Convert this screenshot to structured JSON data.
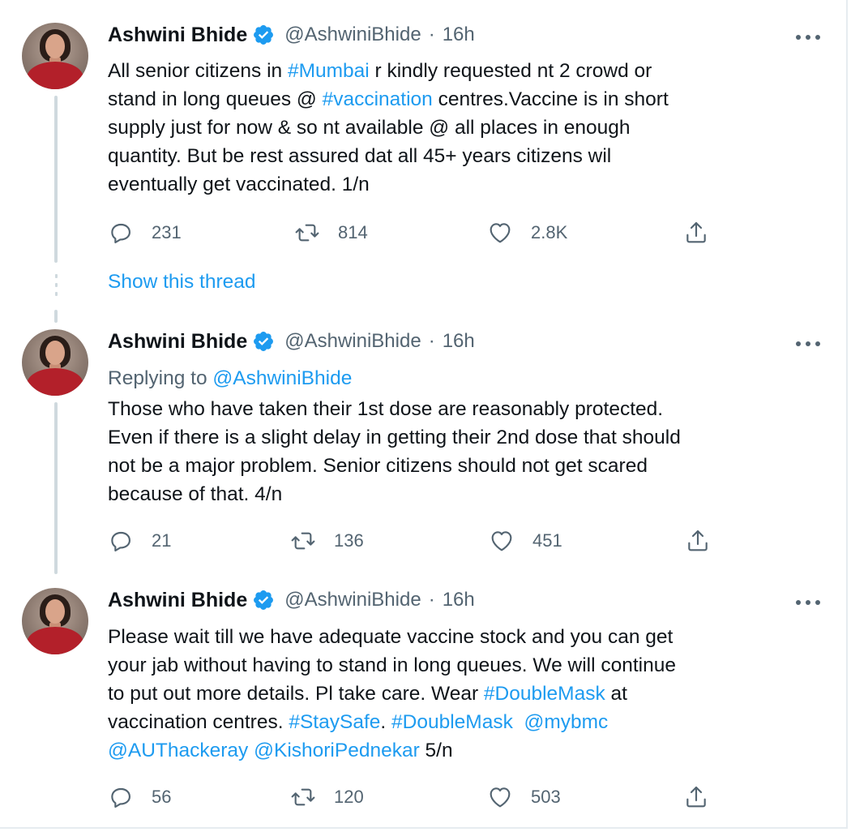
{
  "colors": {
    "link": "#1d9bf0",
    "secondary": "#536471",
    "verified": "#1d9bf0",
    "text": "#0f1419"
  },
  "show_thread": "Show this thread",
  "tweets": [
    {
      "author": {
        "name": "Ashwini Bhide",
        "handle": "@AshwiniBhide",
        "sep": "·",
        "time": "16h",
        "verified": true
      },
      "replying_prefix": "",
      "replying_to": "",
      "lines": [
        [
          {
            "t": "All senior citizens in "
          },
          {
            "t": "#Mumbai",
            "link": true
          },
          {
            "t": " r kindly requested nt 2 crowd or"
          }
        ],
        [
          {
            "t": "stand in long queues @ "
          },
          {
            "t": "#vaccination",
            "link": true
          },
          {
            "t": " centres.Vaccine is in short"
          }
        ],
        [
          {
            "t": "supply just for now & so nt available @ all places in enough"
          }
        ],
        [
          {
            "t": "quantity. But be rest assured dat all 45+ years citizens wil"
          }
        ],
        [
          {
            "t": "eventually get vaccinated. 1/n"
          }
        ]
      ],
      "stats": {
        "replies": "231",
        "retweets": "814",
        "likes": "2.8K"
      }
    },
    {
      "author": {
        "name": "Ashwini Bhide",
        "handle": "@AshwiniBhide",
        "sep": "·",
        "time": "16h",
        "verified": true
      },
      "replying_prefix": "Replying to ",
      "replying_to": "@AshwiniBhide",
      "lines": [
        [
          {
            "t": "Those who have taken their 1st dose are reasonably protected."
          }
        ],
        [
          {
            "t": "Even if there is a slight delay in getting their 2nd dose that should"
          }
        ],
        [
          {
            "t": "not be a major problem. Senior citizens should not get scared"
          }
        ],
        [
          {
            "t": "because of that. 4/n"
          }
        ]
      ],
      "stats": {
        "replies": "21",
        "retweets": "136",
        "likes": "451"
      }
    },
    {
      "author": {
        "name": "Ashwini Bhide",
        "handle": "@AshwiniBhide",
        "sep": "·",
        "time": "16h",
        "verified": true
      },
      "replying_prefix": "",
      "replying_to": "",
      "lines": [
        [
          {
            "t": "Please wait till we have adequate vaccine stock and you can get"
          }
        ],
        [
          {
            "t": "your jab without having to stand in long queues. We will continue"
          }
        ],
        [
          {
            "t": "to put out more details. Pl take care. Wear "
          },
          {
            "t": "#DoubleMask",
            "link": true
          },
          {
            "t": " at"
          }
        ],
        [
          {
            "t": "vaccination centres. "
          },
          {
            "t": "#StaySafe",
            "link": true
          },
          {
            "t": ". "
          },
          {
            "t": "#DoubleMask",
            "link": true
          },
          {
            "t": "  "
          },
          {
            "t": "@mybmc",
            "link": true
          }
        ],
        [
          {
            "t": "@AUThackeray",
            "link": true
          },
          {
            "t": " "
          },
          {
            "t": "@KishoriPednekar",
            "link": true
          },
          {
            "t": " 5/n"
          }
        ]
      ],
      "stats": {
        "replies": "56",
        "retweets": "120",
        "likes": "503"
      }
    }
  ]
}
